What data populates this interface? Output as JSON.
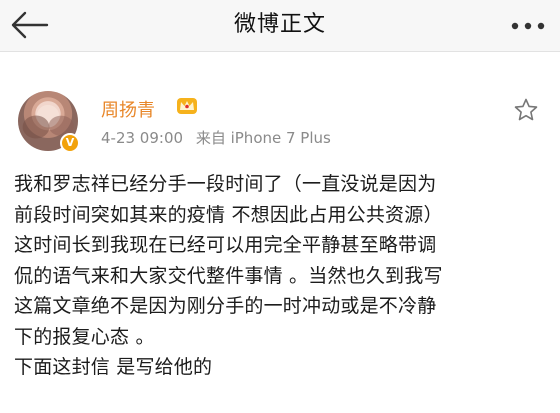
{
  "navbar": {
    "title": "微博正文",
    "back_icon": "back-arrow-icon",
    "more_icon": "more-dots-icon"
  },
  "post": {
    "author": {
      "name": "周扬青",
      "verified_badge": "V",
      "crown_icon": "crown-icon",
      "name_color": "#e8872a"
    },
    "time": "4-23 09:00",
    "source": "来自 iPhone 7 Plus",
    "favorite_icon": "star-outline-icon",
    "lines": [
      "我和罗志祥已经分手一段时间了（一直没说是因为",
      "前段时间突如其来的疫情 不想因此占用公共资源）",
      "这时间长到我现在已经可以用完全平静甚至略带调",
      "侃的语气来和大家交代整件事情 。当然也久到我写",
      "这篇文章绝不是因为刚分手的一时冲动或是不冷静",
      "下的报复心态 。",
      "下面这封信 是写给他的"
    ]
  }
}
